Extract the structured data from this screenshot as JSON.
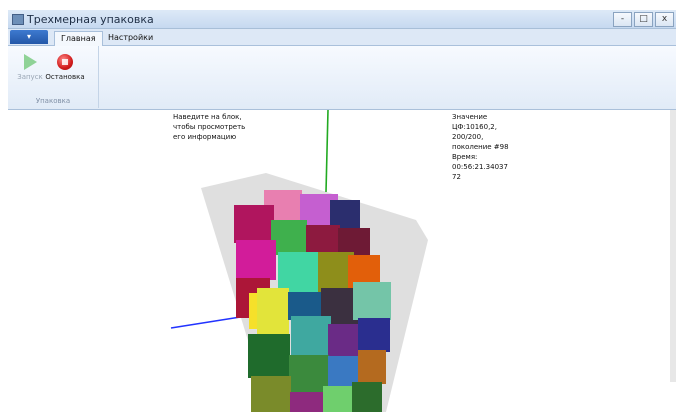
{
  "window": {
    "title": "Трехмерная упаковка",
    "controls": [
      "-",
      "□",
      "x"
    ]
  },
  "ribbon": {
    "app_menu_arrow": "▾",
    "tabs": [
      {
        "label": "Главная",
        "active": true
      },
      {
        "label": "Настройки",
        "active": false
      }
    ],
    "group": {
      "label": "Упаковка",
      "buttons": [
        {
          "label": "Запуск",
          "icon": "play-icon",
          "enabled": false
        },
        {
          "label": "Остановка",
          "icon": "stop-icon",
          "enabled": true
        }
      ]
    }
  },
  "viewport": {
    "hint": "Наведите на блок, чтобы просмотреть его информацию",
    "info": "Значение ЦФ:10160,2, 200/200, поколение #98 Время: 00:56:21.34037 72",
    "axis_colors": {
      "x": "#ff2020",
      "y": "#22aa22",
      "z": "#2233ff"
    }
  }
}
